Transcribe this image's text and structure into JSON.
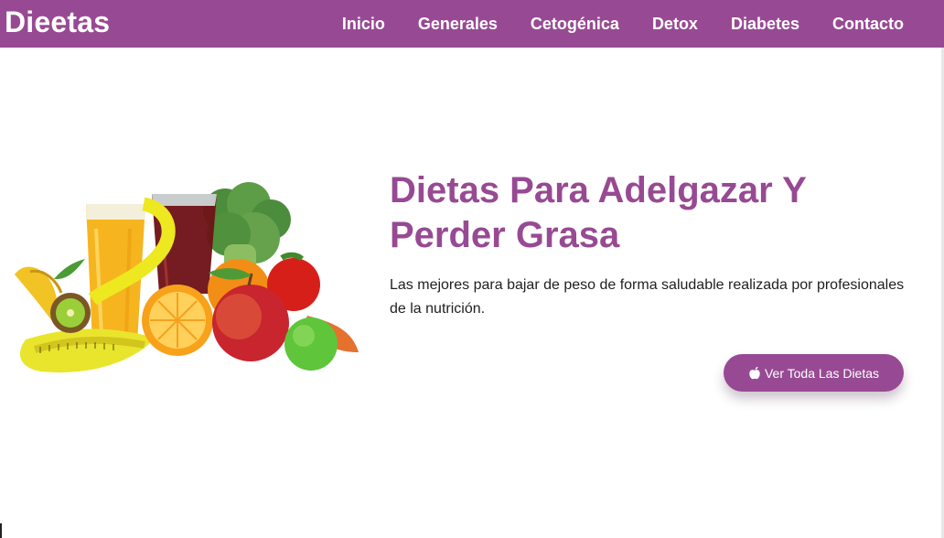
{
  "header": {
    "brand": "Dieetas",
    "nav": [
      "Inicio",
      "Generales",
      "Cetogénica",
      "Detox",
      "Diabetes",
      "Contacto"
    ]
  },
  "hero": {
    "title": "Dietas Para Adelgazar Y Perder Grasa",
    "subtitle": "Las mejores para bajar de peso de forma saludable realizada por profesionales de la nutrición.",
    "cta_label": "Ver Toda Las Dietas",
    "cta_icon": "apple-icon"
  },
  "colors": {
    "primary": "#974a93",
    "text": "#1f1f1f",
    "background": "#ffffff"
  }
}
